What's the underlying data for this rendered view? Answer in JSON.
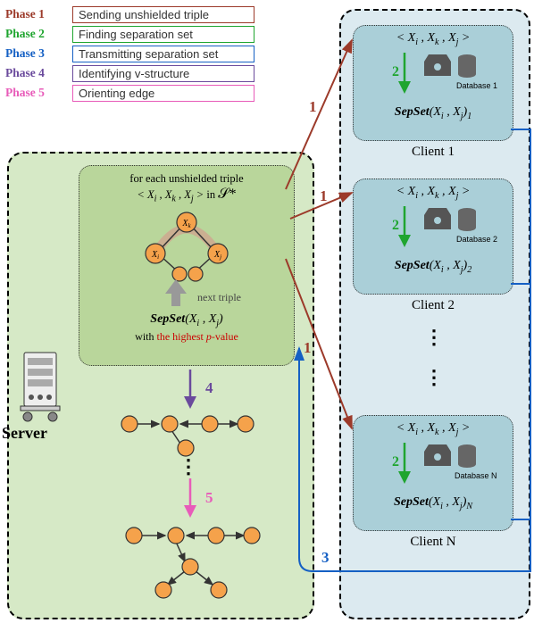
{
  "legend": {
    "rows": [
      {
        "phase": "Phase 1",
        "desc": "Sending unshielded triple",
        "color": "#9c3a2a"
      },
      {
        "phase": "Phase 2",
        "desc": "Finding separation set",
        "color": "#1fa52f"
      },
      {
        "phase": "Phase 3",
        "desc": "Transmitting separation set",
        "color": "#1560c4"
      },
      {
        "phase": "Phase 4",
        "desc": "Identifying v-structure",
        "color": "#6a4a9c"
      },
      {
        "phase": "Phase 5",
        "desc": "Orienting edge",
        "color": "#e85bb9"
      }
    ]
  },
  "server": {
    "label": "Server",
    "caption_line1": "for each unshielded triple",
    "caption_in": "in",
    "set_symbol": "𝒮*",
    "triple": "< X_i , X_k , X_j >",
    "next": "next triple",
    "sepset": "SepSet",
    "separgs": "(X_i , X_j)",
    "highest": "with the highest p-value"
  },
  "clients": [
    {
      "triple": "< X_i , X_k , X_j >",
      "db": "Database 1",
      "sepset": "SepSet",
      "args": "(X_i , X_j)",
      "sub": "1",
      "label": "Client 1"
    },
    {
      "triple": "< X_i , X_k , X_j >",
      "db": "Database 2",
      "sepset": "SepSet",
      "args": "(X_i , X_j)",
      "sub": "2",
      "label": "Client 2"
    },
    {
      "triple": "< X_i , X_k , X_j >",
      "db": "Database N",
      "sepset": "SepSet",
      "args": "(X_i , X_j)",
      "sub": "N",
      "label": "Client N"
    }
  ],
  "nums": {
    "p1": "1",
    "p2": "2",
    "p3": "3",
    "p4": "4",
    "p5": "5"
  }
}
